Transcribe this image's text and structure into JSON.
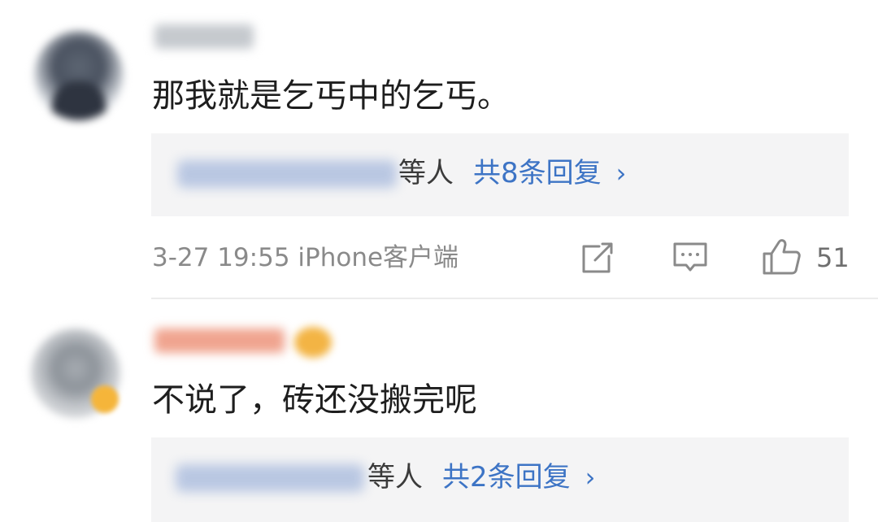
{
  "comments": [
    {
      "text": "那我就是乞丐中的乞丐。",
      "reply_preview": {
        "others_label": "等人",
        "count_label": "共8条回复",
        "chevron": "›"
      },
      "meta": "3-27 19:55 iPhone客户端",
      "like_count": "51"
    },
    {
      "text": "不说了，砖还没搬完呢",
      "reply_preview": {
        "others_label": "等人",
        "count_label": "共2条回复",
        "chevron": "›"
      }
    }
  ],
  "icons": {
    "share": "share-icon",
    "comment": "comment-icon",
    "like": "like-icon"
  },
  "colors": {
    "link_blue": "#3d74c5",
    "meta_gray": "#8a8a8a",
    "reply_bg": "#f4f4f5"
  }
}
